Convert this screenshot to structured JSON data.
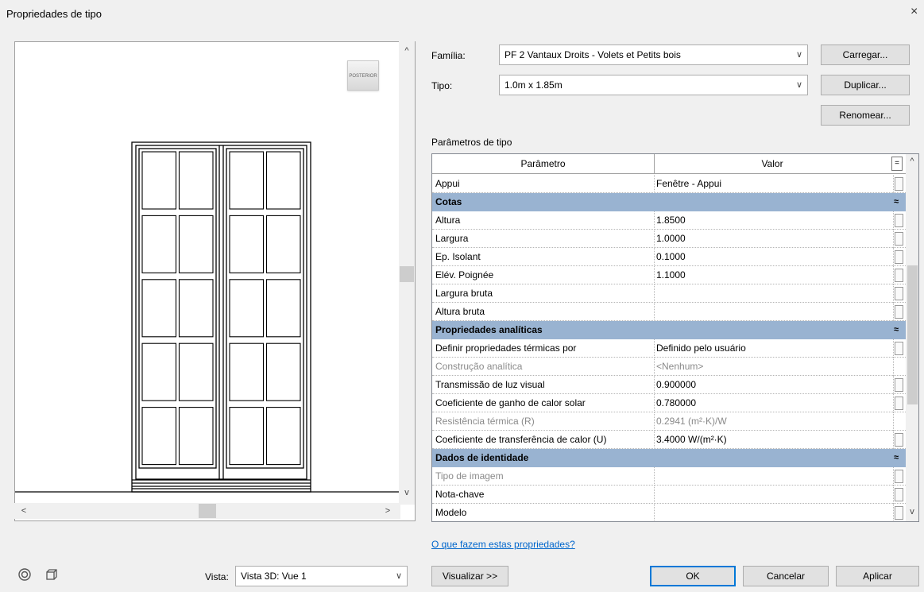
{
  "dialog": {
    "title": "Propriedades de tipo",
    "close_glyph": "×"
  },
  "preview": {
    "viewcube_label": "POSTERIOR",
    "scroll_up": "^",
    "scroll_down": "v",
    "scroll_left": "<",
    "scroll_right": ">",
    "vista_label": "Vista:",
    "vista_value": "Vista 3D: Vue 1",
    "visualizar_label": "Visualizar >>"
  },
  "form": {
    "familia_label": "Família:",
    "familia_value": "PF 2 Vantaux Droits - Volets et Petits bois",
    "tipo_label": "Tipo:",
    "tipo_value": "1.0m x 1.85m",
    "carregar_label": "Carregar...",
    "duplicar_label": "Duplicar...",
    "renomear_label": "Renomear...",
    "chevron": "∨"
  },
  "table": {
    "section_label": "Parâmetros de tipo",
    "col_param": "Parâmetro",
    "col_value": "Valor",
    "sort_glyph": "=",
    "collapse_glyph": "≈",
    "rows": [
      {
        "p": "Appui",
        "v": "Fenêtre - Appui"
      },
      {
        "p": "Cotas",
        "v": "",
        "group": true
      },
      {
        "p": "Altura",
        "v": "1.8500"
      },
      {
        "p": "Largura",
        "v": "1.0000"
      },
      {
        "p": "Ep. Isolant",
        "v": "0.1000"
      },
      {
        "p": "Elév. Poignée",
        "v": "1.1000"
      },
      {
        "p": "Largura bruta",
        "v": ""
      },
      {
        "p": "Altura bruta",
        "v": ""
      },
      {
        "p": "Propriedades analíticas",
        "v": "",
        "group": true
      },
      {
        "p": "Definir propriedades térmicas por",
        "v": "Definido pelo usuário"
      },
      {
        "p": "Construção analítica",
        "v": "<Nenhum>",
        "dis": true
      },
      {
        "p": "Transmissão de luz visual",
        "v": "0.900000"
      },
      {
        "p": "Coeficiente de ganho de calor solar",
        "v": "0.780000"
      },
      {
        "p": "Resistência térmica (R)",
        "v": "0.2941 (m²·K)/W",
        "dis": true
      },
      {
        "p": "Coeficiente de transferência de calor (U)",
        "v": "3.4000 W/(m²·K)"
      },
      {
        "p": "Dados de identidade",
        "v": "",
        "group": true
      },
      {
        "p": "Tipo de imagem",
        "v": "",
        "dis": true
      },
      {
        "p": "Nota-chave",
        "v": ""
      },
      {
        "p": "Modelo",
        "v": ""
      }
    ]
  },
  "footer": {
    "help_link": "O que fazem estas propriedades?",
    "ok_label": "OK",
    "cancelar_label": "Cancelar",
    "aplicar_label": "Aplicar"
  }
}
